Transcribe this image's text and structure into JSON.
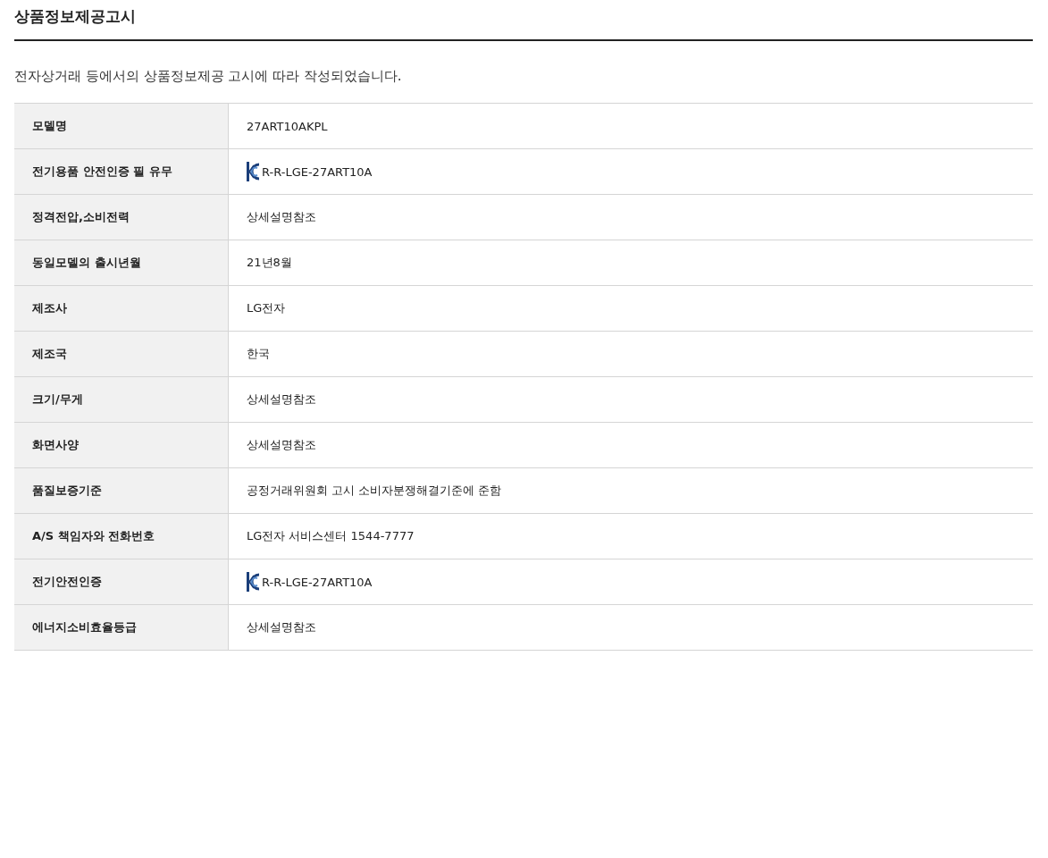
{
  "title": "상품정보제공고시",
  "notice": "전자상거래 등에서의 상품정보제공 고시에 따라 작성되었습니다.",
  "rows": [
    {
      "label": "모델명",
      "value": "27ART10AKPL",
      "kind": "text"
    },
    {
      "label": "전기용품 안전인증 필 유무",
      "value": "R-R-LGE-27ART10A",
      "kind": "certificate"
    },
    {
      "label": "정격전압,소비전력",
      "value": "상세설명참조",
      "kind": "text"
    },
    {
      "label": "동일모델의 출시년월",
      "value": "21년8월",
      "kind": "text"
    },
    {
      "label": "제조사",
      "value": "LG전자",
      "kind": "text"
    },
    {
      "label": "제조국",
      "value": "한국",
      "kind": "text"
    },
    {
      "label": "크기/무게",
      "value": "상세설명참조",
      "kind": "text"
    },
    {
      "label": "화면사양",
      "value": "상세설명참조",
      "kind": "text"
    },
    {
      "label": "품질보증기준",
      "value": "공정거래위원회 고시 소비자분쟁해결기준에 준함",
      "kind": "text"
    },
    {
      "label": "A/S 책임자와 전화번호",
      "value": "LG전자 서비스센터 1544-7777",
      "kind": "text"
    },
    {
      "label": "전기안전인증",
      "value": "R-R-LGE-27ART10A",
      "kind": "certificate"
    },
    {
      "label": "에너지소비효율등급",
      "value": "상세설명참조",
      "kind": "text"
    }
  ]
}
